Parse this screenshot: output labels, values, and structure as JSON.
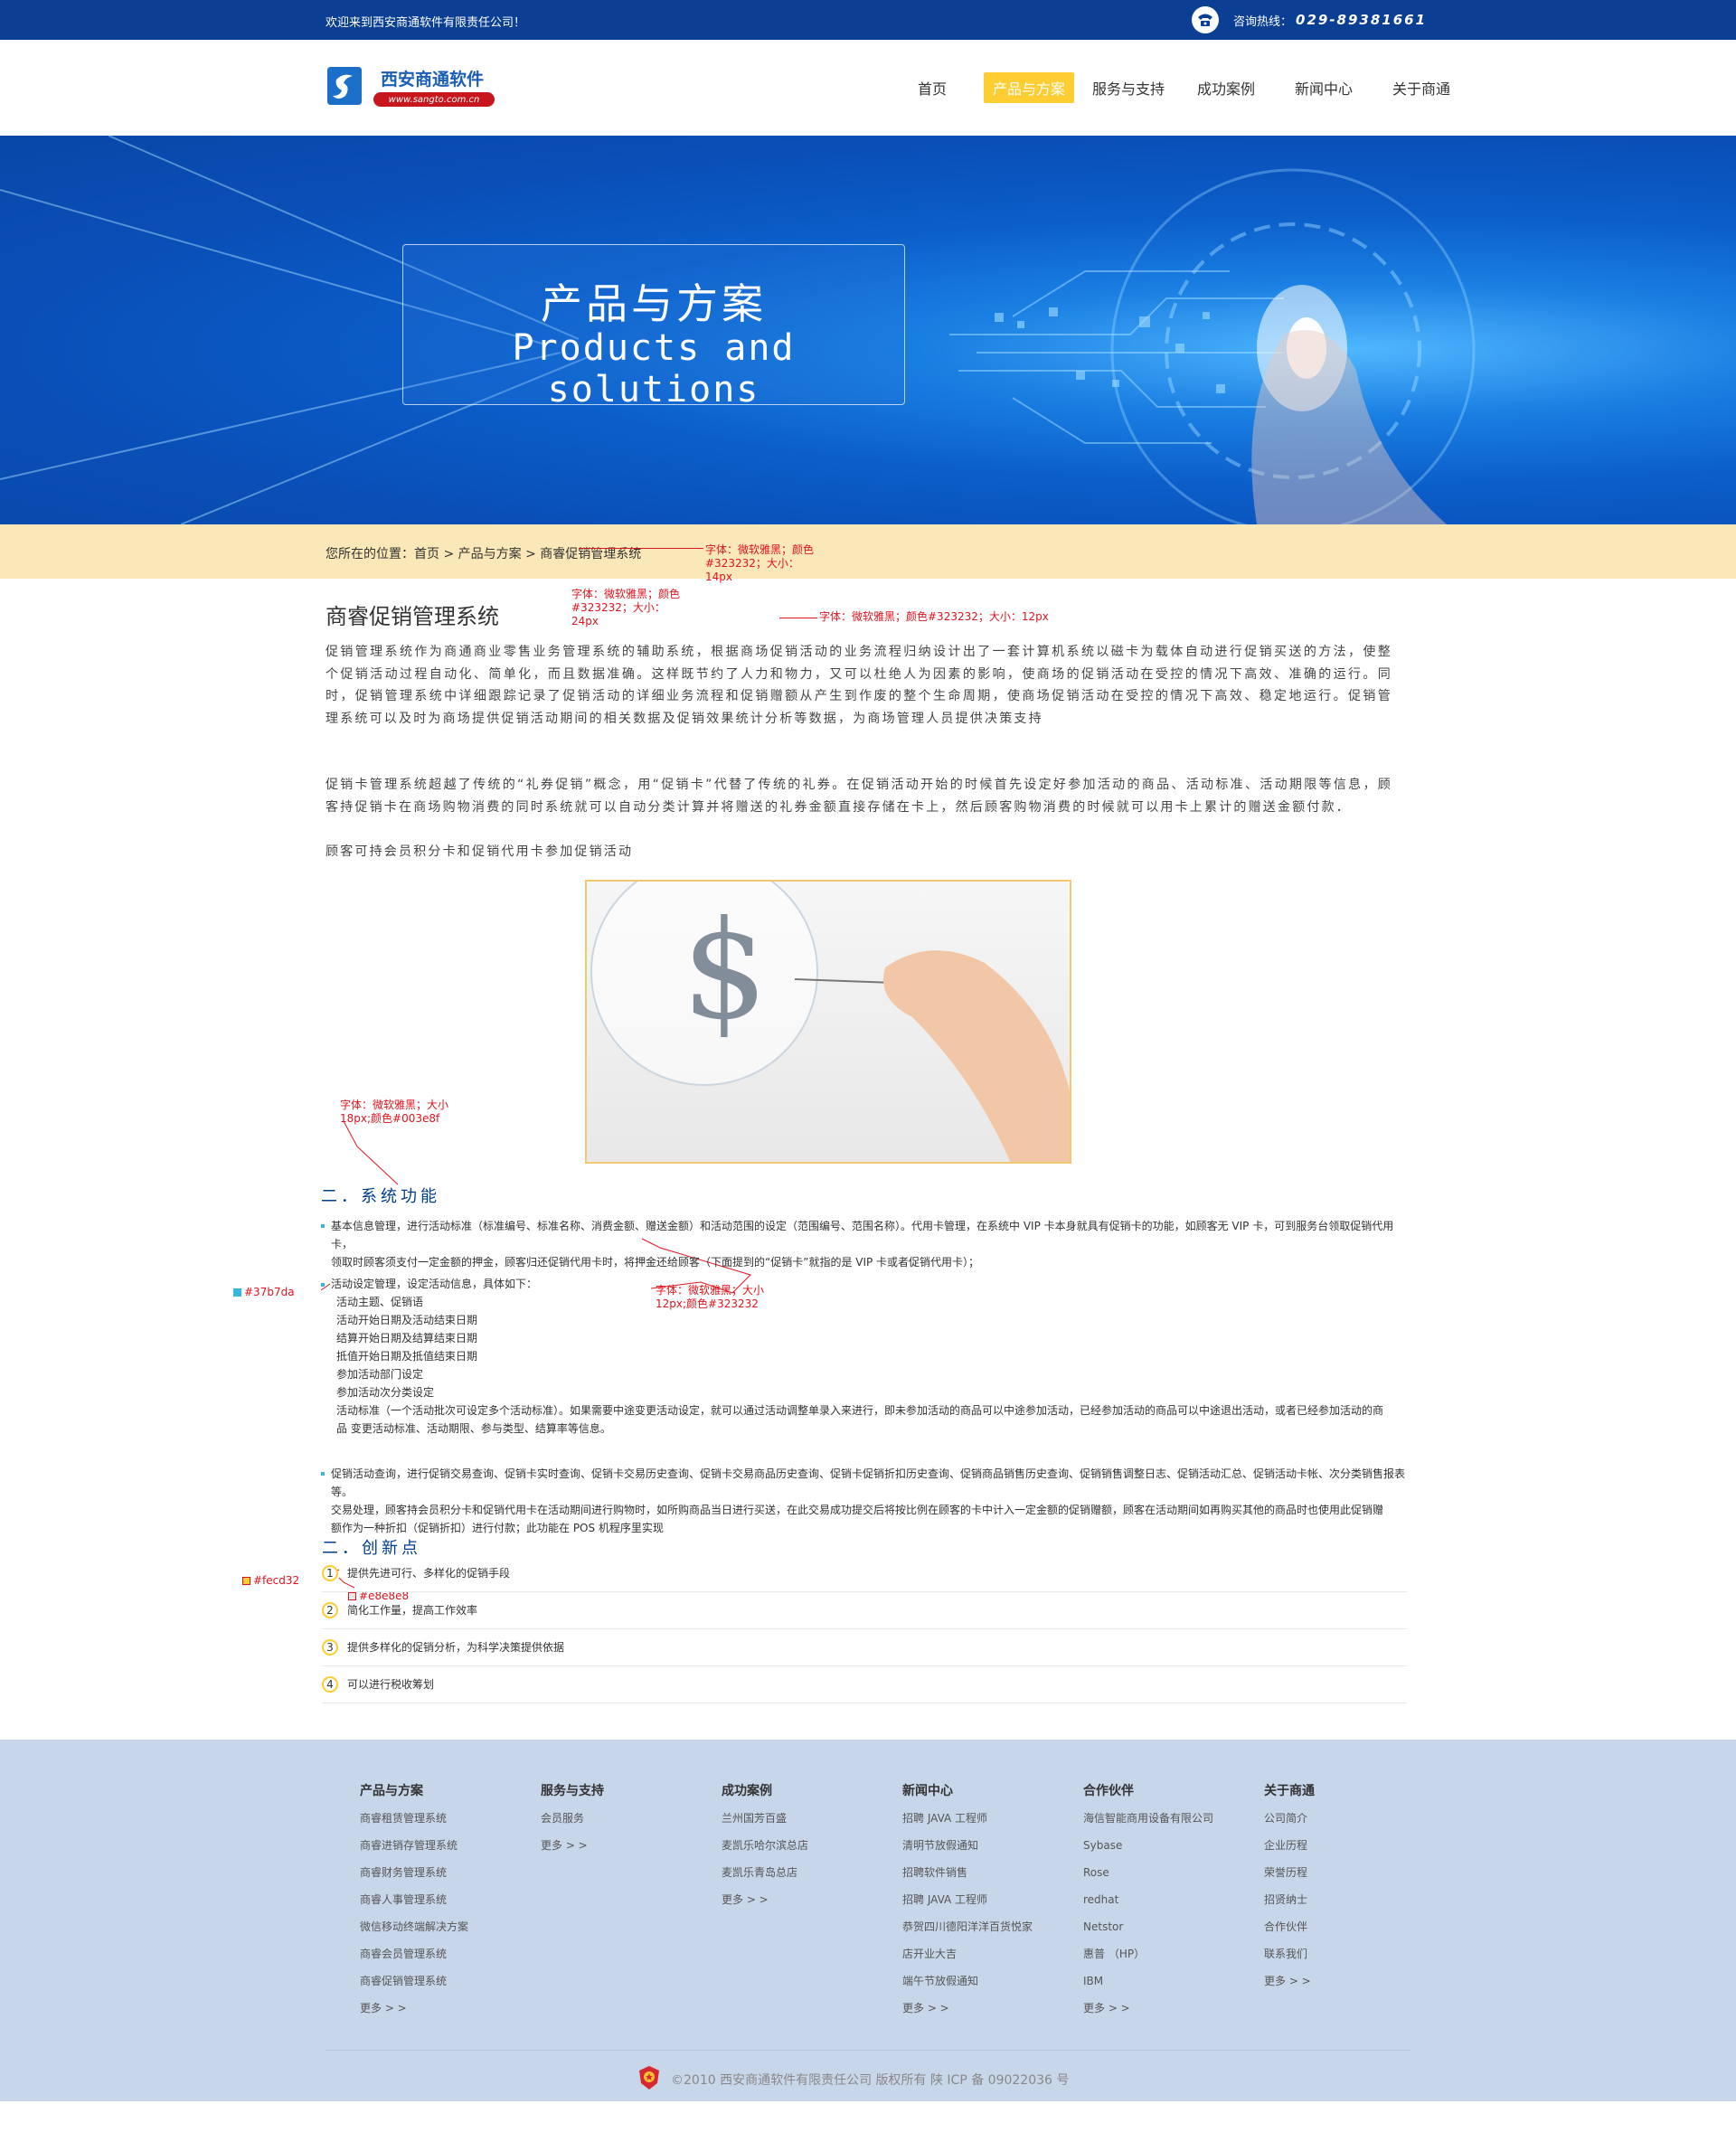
{
  "topbar": {
    "welcome": "欢迎来到西安商通软件有限责任公司！",
    "hotline_label": "咨询热线：",
    "hotline_number": "029-89381661"
  },
  "header": {
    "logo_name": "西安商通软件",
    "logo_url": "www.sangto.com.cn",
    "nav": [
      "首页",
      "产品与方案",
      "服务与支持",
      "成功案例",
      "新闻中心",
      "关于商通"
    ],
    "active_nav": "产品与方案"
  },
  "banner": {
    "title_cn": "产品与方案",
    "title_en": "Products and solutions"
  },
  "breadcrumb": "您所在的位置：首页 > 产品与方案 > 商睿促销管理系统",
  "annotations": {
    "crumb_note": [
      "字体：微软雅黑；颜色",
      "#323232；大小：",
      "14px"
    ],
    "title_note": [
      "字体：微软雅黑；颜色",
      "#323232；大小：",
      "24px"
    ],
    "para_note": "字体：微软雅黑；颜色#323232；大小：12px",
    "h2_note": [
      "字体：微软雅黑；大小",
      "18px;颜色#003e8f"
    ],
    "list_note": [
      "字体：微软雅黑；大小",
      "12px;颜色#323232"
    ],
    "bullet_color": "#37b7da",
    "num_color": "#fecd32",
    "line_color": "#e8e8e8"
  },
  "content": {
    "title": "商睿促销管理系统",
    "para1": "促销管理系统作为商通商业零售业务管理系统的辅助系统，根据商场促销活动的业务流程归纳设计出了一套计算机系统以磁卡为载体自动进行促销买送的方法，使整个促销活动过程自动化、简单化，而且数据准确。这样既节约了人力和物力，又可以杜绝人为因素的影响，使商场的促销活动在受控的情况下高效、准确的运行。同时，促销管理系统中详细跟踪记录了促销活动的详细业务流程和促销赠额从产生到作废的整个生命周期，使商场促销活动在受控的情况下高效、稳定地运行。促销管理系统可以及时为商场提供促销活动期间的相关数据及促销效果统计分析等数据，为商场管理人员提供决策支持",
    "para2": "促销卡管理系统超越了传统的“礼券促销”概念，用“促销卡”代替了传统的礼券。在促销活动开始的时候首先设定好参加活动的商品、活动标准、活动期限等信息，顾客持促销卡在商场购物消费的同时系统就可以自动分类计算并将赠送的礼券金额直接存储在卡上，然后顾客购物消费的时候就可以用卡上累计的赠送金额付款．",
    "para3": "顾客可持会员积分卡和促销代用卡参加促销活动",
    "section1_title": "二．系统功能",
    "item1": [
      "基本信息管理，进行活动标准（标准编号、标准名称、消费金额、赠送金额）和活动范围的设定（范围编号、范围名称）。代用卡管理，在系统中 VIP 卡本身就具有促销卡的功能，如顾客无 VIP 卡，可到服务台领取促销代用卡，",
      "领取时顾客须支付一定金额的押金，顾客归还促销代用卡时，将押金还给顾客（下面提到的“促销卡”就指的是 VIP 卡或者促销代用卡）；"
    ],
    "item2_head": "活动设定管理，设定活动信息，具体如下：",
    "item2_lines": [
      "活动主题、促销语",
      "活动开始日期及活动结束日期",
      "结算开始日期及结算结束日期",
      "抵值开始日期及抵值结束日期",
      "参加活动部门设定",
      "参加活动次分类设定",
      "活动标准（一个活动批次可设定多个活动标准）。如果需要中途变更活动设定，就可以通过活动调整单录入来进行，即未参加活动的商品可以中途参加活动，已经参加活动的商品可以中途退出活动，或者已经参加活动的商",
      "品 变更活动标准、活动期限、参与类型、结算率等信息。"
    ],
    "item3": [
      "促销活动查询，进行促销交易查询、促销卡实时查询、促销卡交易历史查询、促销卡交易商品历史查询、促销卡促销折扣历史查询、促销商品销售历史查询、促销销售调整日志、促销活动汇总、促销活动卡帐、次分类销售报表等。",
      "交易处理，顾客持会员积分卡和促销代用卡在活动期间进行购物时，如所购商品当日进行买送，在此交易成功提交后将按比例在顾客的卡中计入一定金额的促销赠额，顾客在活动期间如再购买其他的商品时也使用此促销赠",
      "额作为一种折扣（促销折扣）进行付款；此功能在 POS 机程序里实现"
    ],
    "section2_title": "二．创新点",
    "innovations": [
      {
        "num": "1",
        "text": "提供先进可行、多样化的促销手段"
      },
      {
        "num": "2",
        "text": "简化工作量，提高工作效率"
      },
      {
        "num": "3",
        "text": "提供多样化的促销分析，为科学决策提供依据"
      },
      {
        "num": "4",
        "text": "可以进行税收筹划"
      }
    ]
  },
  "footer": {
    "columns": [
      {
        "title": "产品与方案",
        "items": [
          "商睿租赁管理系统",
          "商睿进销存管理系统",
          "商睿财务管理系统",
          "商睿人事管理系统",
          "微信移动终端解决方案",
          "商睿会员管理系统",
          "商睿促销管理系统",
          "更多 > >"
        ]
      },
      {
        "title": "服务与支持",
        "items": [
          "会员服务",
          "更多 > >"
        ]
      },
      {
        "title": "成功案例",
        "items": [
          "兰州国芳百盛",
          "麦凯乐哈尔滨总店",
          "麦凯乐青岛总店",
          "更多 > >"
        ]
      },
      {
        "title": "新闻中心",
        "items": [
          "招聘 JAVA 工程师",
          "清明节放假通知",
          "招聘软件销售",
          "招聘 JAVA 工程师",
          "恭贺四川德阳洋洋百货悦家",
          "店开业大吉",
          "端午节放假通知",
          "更多 > >"
        ]
      },
      {
        "title": "合作伙伴",
        "items": [
          "海信智能商用设备有限公司",
          "Sybase",
          "Rose",
          "redhat",
          "Netstor",
          "惠普 （HP）",
          "IBM",
          "更多 > >"
        ]
      },
      {
        "title": "关于商通",
        "items": [
          "公司简介",
          "企业历程",
          "荣誉历程",
          "招贤纳士",
          "合作伙伴",
          "联系我们",
          "更多 > >"
        ]
      }
    ],
    "copyright": "©2010 西安商通软件有限责任公司 版权所有   陕 ICP 备 09022036 号"
  }
}
